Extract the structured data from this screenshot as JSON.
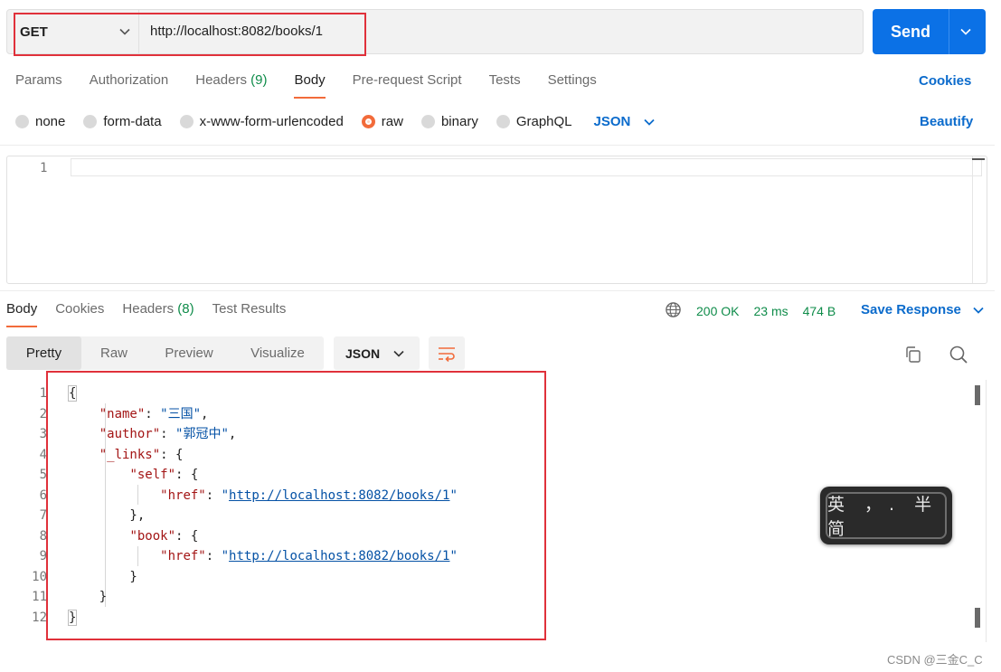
{
  "request": {
    "method": "GET",
    "url": "http://localhost:8082/books/1",
    "send_label": "Send"
  },
  "request_tabs": [
    {
      "label": "Params"
    },
    {
      "label": "Authorization"
    },
    {
      "label": "Headers",
      "count": "(9)"
    },
    {
      "label": "Body",
      "active": true
    },
    {
      "label": "Pre-request Script"
    },
    {
      "label": "Tests"
    },
    {
      "label": "Settings"
    }
  ],
  "cookies_label": "Cookies",
  "body_types": {
    "options": [
      "none",
      "form-data",
      "x-www-form-urlencoded",
      "raw",
      "binary",
      "GraphQL"
    ],
    "selected": "raw",
    "format": "JSON"
  },
  "beautify_label": "Beautify",
  "request_editor": {
    "line_numbers": [
      "1"
    ]
  },
  "response_tabs": [
    {
      "label": "Body",
      "active": true
    },
    {
      "label": "Cookies"
    },
    {
      "label": "Headers",
      "count": "(8)"
    },
    {
      "label": "Test Results"
    }
  ],
  "response_status": {
    "status": "200 OK",
    "time": "23 ms",
    "size": "474 B"
  },
  "save_response_label": "Save Response",
  "view_tabs": [
    "Pretty",
    "Raw",
    "Preview",
    "Visualize"
  ],
  "view_active": "Pretty",
  "response_format": "JSON",
  "response_body": {
    "line_numbers": [
      "1",
      "2",
      "3",
      "4",
      "5",
      "6",
      "7",
      "8",
      "9",
      "10",
      "11",
      "12"
    ],
    "l1": "{",
    "name_key": "\"name\"",
    "name_val": "\"三国\"",
    "author_key": "\"author\"",
    "author_val": "\"郭冠中\"",
    "links_key": "\"_links\"",
    "self_key": "\"self\"",
    "href_key": "\"href\"",
    "href_val": "http://localhost:8082/books/1",
    "book_key": "\"book\"",
    "l12": "}"
  },
  "ime_indicator": "英 ，. 半 简",
  "watermark": "CSDN @三金C_C",
  "colors": {
    "accent": "#f26b3a",
    "send": "#0b71e6",
    "link": "#0b6bcc",
    "status_ok": "#0f8c4a",
    "highlight_box": "#e0313b"
  }
}
